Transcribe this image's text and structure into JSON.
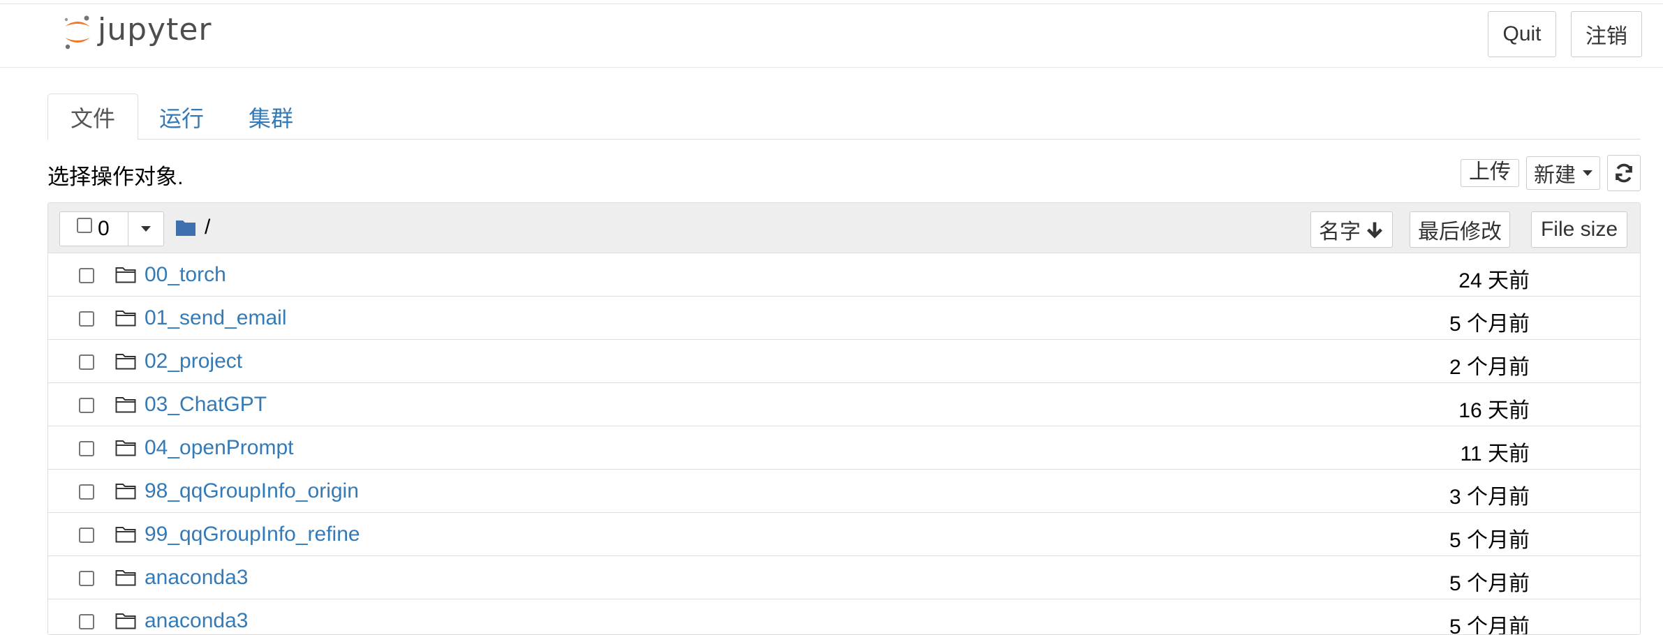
{
  "header": {
    "logo_text": "jupyter",
    "quit_label": "Quit",
    "logout_label": "注销"
  },
  "tabs": [
    {
      "label": "文件",
      "active": true
    },
    {
      "label": "运行",
      "active": false
    },
    {
      "label": "集群",
      "active": false
    }
  ],
  "toolbar": {
    "select_message": "选择操作对象.",
    "upload_label": "上传",
    "new_label": "新建",
    "refresh_icon": "refresh-icon"
  },
  "list_header": {
    "selected_count": "0",
    "breadcrumb_path": "/",
    "sort_name_label": "名字",
    "sort_modified_label": "最后修改",
    "sort_size_label": "File size"
  },
  "files": [
    {
      "name": "00_torch",
      "modified": "24 天前"
    },
    {
      "name": "01_send_email",
      "modified": "5 个月前"
    },
    {
      "name": "02_project",
      "modified": "2 个月前"
    },
    {
      "name": "03_ChatGPT",
      "modified": "16 天前"
    },
    {
      "name": "04_openPrompt",
      "modified": "11 天前"
    },
    {
      "name": "98_qqGroupInfo_origin",
      "modified": "3 个月前"
    },
    {
      "name": "99_qqGroupInfo_refine",
      "modified": "5 个月前"
    },
    {
      "name": "anaconda3",
      "modified": "5 个月前"
    },
    {
      "name": "anaconda3",
      "modified": "5 个月前"
    }
  ],
  "colors": {
    "link": "#337ab7",
    "logo_orange": "#f37626",
    "folder_blue": "#3f6fae"
  }
}
